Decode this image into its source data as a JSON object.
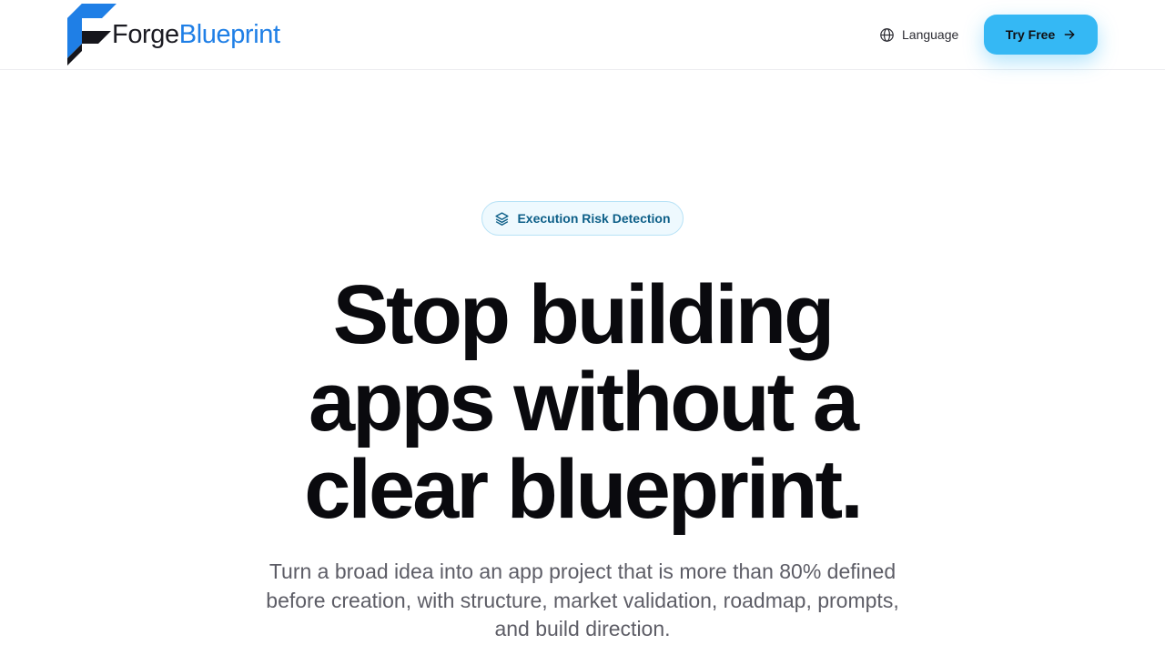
{
  "header": {
    "logo": {
      "brand_part1": "Forge",
      "brand_part2": "Blueprint",
      "icon": "forge-f-logo-mark"
    },
    "language": {
      "label": "Language",
      "icon": "globe-icon"
    },
    "cta": {
      "label": "Try Free",
      "icon": "arrow-right-icon"
    }
  },
  "hero": {
    "badge": {
      "label": "Execution Risk Detection",
      "icon": "layers-icon"
    },
    "title_lines": [
      "Stop building",
      "apps without a",
      "clear blueprint."
    ],
    "subtitle_lines": [
      "Turn a broad idea into an app project that is more than 80% defined",
      "before creation, with structure, market validation, roadmap, prompts,",
      "and build direction."
    ]
  },
  "colors": {
    "accent": "#35b8f4",
    "brand_blue": "#1f7fe6",
    "badge_text": "#0d5f88",
    "badge_bg": "#eef9fe",
    "heading": "#0a0a0e",
    "body_text": "#5d5d66"
  }
}
